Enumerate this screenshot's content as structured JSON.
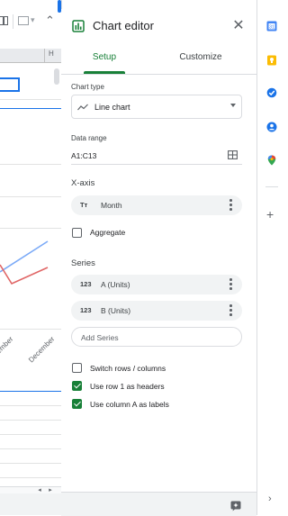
{
  "editor": {
    "title": "Chart editor",
    "tabs": {
      "setup": "Setup",
      "customize": "Customize"
    },
    "chart_type_label": "Chart type",
    "chart_type_value": "Line chart",
    "data_range_label": "Data range",
    "data_range_value": "A1:C13",
    "xaxis_label": "X-axis",
    "xaxis_chip": {
      "icon": "Tт",
      "label": "Month"
    },
    "aggregate_label": "Aggregate",
    "aggregate_checked": false,
    "series_label": "Series",
    "series": [
      {
        "icon": "123",
        "label": "A (Units)"
      },
      {
        "icon": "123",
        "label": "B (Units)"
      }
    ],
    "add_series": "Add Series",
    "options": [
      {
        "label": "Switch rows / columns",
        "checked": false
      },
      {
        "label": "Use row 1 as headers",
        "checked": true
      },
      {
        "label": "Use column A as labels",
        "checked": true
      }
    ]
  },
  "sheet": {
    "column_header": "H",
    "month_labels": [
      "ember",
      "December"
    ],
    "chart_colors": {
      "series_a": "#7baaf7",
      "series_b": "#e06666"
    }
  },
  "colors": {
    "accent_green": "#188038",
    "selection_blue": "#1a73e8"
  },
  "rail_icons": [
    "calendar-icon",
    "keep-icon",
    "tasks-icon",
    "contacts-icon",
    "maps-icon"
  ]
}
